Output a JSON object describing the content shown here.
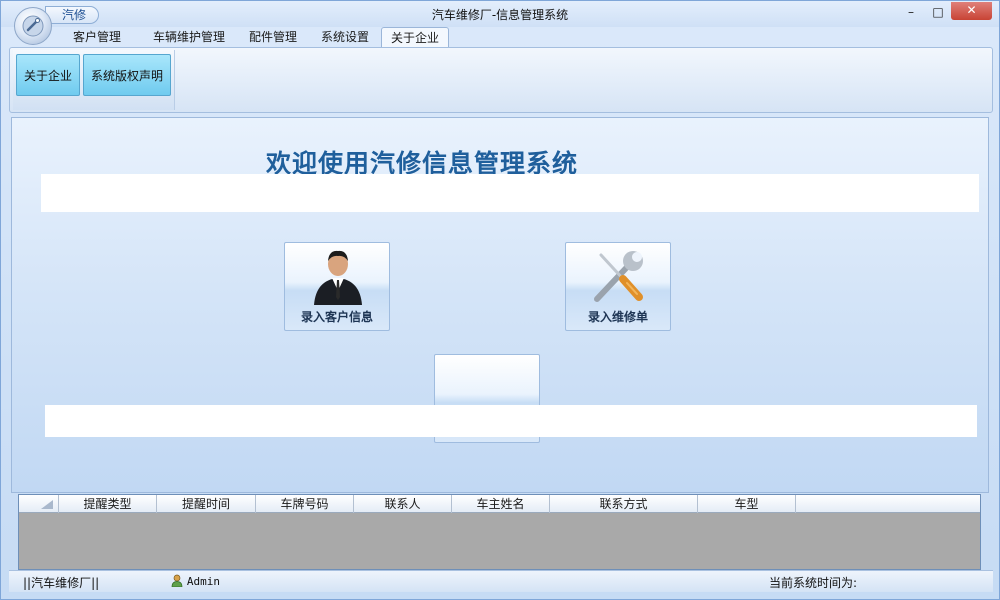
{
  "window": {
    "title": "汽车维修厂-信息管理系统",
    "qat_label": "汽修",
    "controls": {
      "minimize": "–",
      "maximize": "□",
      "close": "✕"
    }
  },
  "tabs": [
    {
      "label": "客户管理"
    },
    {
      "label": "车辆维护管理"
    },
    {
      "label": "配件管理"
    },
    {
      "label": "系统设置"
    },
    {
      "label": "关于企业",
      "active": true
    }
  ],
  "ribbon": {
    "buttons": [
      {
        "label": "关于企业"
      },
      {
        "label": "系统版权声明"
      }
    ]
  },
  "main": {
    "welcome": "欢迎使用汽修信息管理系统",
    "tiles": [
      {
        "label": "录入客户信息",
        "icon": "businessman-icon"
      },
      {
        "label": "录入维修单",
        "icon": "wrench-screwdriver-icon"
      },
      {
        "label": "",
        "icon": ""
      }
    ]
  },
  "grid": {
    "columns": [
      "提醒类型",
      "提醒时间",
      "车牌号码",
      "联系人",
      "车主姓名",
      "联系方式",
      "车型"
    ]
  },
  "status": {
    "company": "||汽车维修厂||",
    "user": "Admin",
    "time_label": "当前系统时间为:"
  },
  "colors": {
    "accent": "#1f5f9c",
    "ribbon_button": "#6fcbef",
    "grid_body": "#a9a9a9"
  }
}
